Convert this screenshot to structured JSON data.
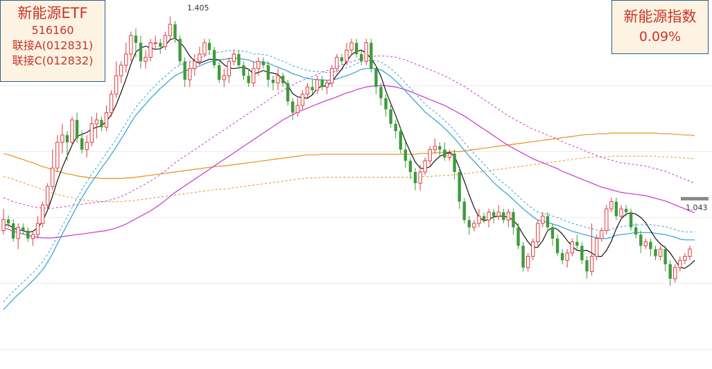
{
  "left_box": {
    "name": "新能源ETF",
    "code": "516160",
    "link_a": "联接A(012831)",
    "link_c": "联接C(012832)"
  },
  "right_box": {
    "name": "新能源指数",
    "pct": "0.09%"
  },
  "annotations": {
    "high_label": "1.405",
    "last_label": "1.043"
  },
  "colors": {
    "up": "#e03a3e",
    "down": "#3e9b3a",
    "ma_short": "#111111",
    "ma_mid": "#2a9fd8",
    "ma_long": "#cc33cc",
    "ma_longest": "#e8901c",
    "box_bg": "#fdf3e2",
    "box_text": "#c8342a"
  },
  "chart_data": {
    "type": "candlestick",
    "ylim": [
      0.87,
      1.43
    ],
    "high": 1.405,
    "last": 1.043,
    "candles": [
      [
        1.08,
        1.097,
        1.113,
        1.074
      ],
      [
        1.097,
        1.091,
        1.103,
        1.085
      ],
      [
        1.091,
        1.068,
        1.097,
        1.063
      ],
      [
        1.068,
        1.085,
        1.091,
        1.052
      ],
      [
        1.085,
        1.08,
        1.091,
        1.074
      ],
      [
        1.08,
        1.068,
        1.085,
        1.063
      ],
      [
        1.068,
        1.074,
        1.08,
        1.057
      ],
      [
        1.074,
        1.091,
        1.102,
        1.068
      ],
      [
        1.091,
        1.119,
        1.124,
        1.085
      ],
      [
        1.119,
        1.147,
        1.152,
        1.113
      ],
      [
        1.147,
        1.175,
        1.203,
        1.141
      ],
      [
        1.175,
        1.214,
        1.225,
        1.169
      ],
      [
        1.214,
        1.225,
        1.242,
        1.197
      ],
      [
        1.225,
        1.214,
        1.231,
        1.186
      ],
      [
        1.214,
        1.248,
        1.253,
        1.208
      ],
      [
        1.248,
        1.22,
        1.259,
        1.214
      ],
      [
        1.22,
        1.203,
        1.231,
        1.197
      ],
      [
        1.203,
        1.214,
        1.225,
        1.191
      ],
      [
        1.214,
        1.242,
        1.253,
        1.208
      ],
      [
        1.242,
        1.248,
        1.259,
        1.22
      ],
      [
        1.248,
        1.237,
        1.253,
        1.231
      ],
      [
        1.237,
        1.259,
        1.27,
        1.231
      ],
      [
        1.259,
        1.287,
        1.293,
        1.253
      ],
      [
        1.287,
        1.315,
        1.337,
        1.281
      ],
      [
        1.315,
        1.331,
        1.337,
        1.304
      ],
      [
        1.331,
        1.348,
        1.365,
        1.32
      ],
      [
        1.348,
        1.376,
        1.382,
        1.337
      ],
      [
        1.376,
        1.365,
        1.387,
        1.343
      ],
      [
        1.365,
        1.337,
        1.376,
        1.326
      ],
      [
        1.337,
        1.343,
        1.354,
        1.326
      ],
      [
        1.343,
        1.365,
        1.371,
        1.337
      ],
      [
        1.365,
        1.365,
        1.376,
        1.354
      ],
      [
        1.365,
        1.359,
        1.371,
        1.348
      ],
      [
        1.359,
        1.376,
        1.382,
        1.354
      ],
      [
        1.376,
        1.393,
        1.405,
        1.371
      ],
      [
        1.393,
        1.371,
        1.398,
        1.365
      ],
      [
        1.371,
        1.337,
        1.376,
        1.331
      ],
      [
        1.337,
        1.309,
        1.343,
        1.298
      ],
      [
        1.309,
        1.326,
        1.337,
        1.298
      ],
      [
        1.326,
        1.337,
        1.348,
        1.315
      ],
      [
        1.337,
        1.348,
        1.359,
        1.331
      ],
      [
        1.348,
        1.365,
        1.371,
        1.343
      ],
      [
        1.365,
        1.354,
        1.371,
        1.348
      ],
      [
        1.354,
        1.331,
        1.359,
        1.326
      ],
      [
        1.331,
        1.309,
        1.337,
        1.304
      ],
      [
        1.309,
        1.315,
        1.326,
        1.298
      ],
      [
        1.315,
        1.337,
        1.343,
        1.304
      ],
      [
        1.337,
        1.348,
        1.354,
        1.331
      ],
      [
        1.348,
        1.331,
        1.354,
        1.326
      ],
      [
        1.331,
        1.315,
        1.337,
        1.309
      ],
      [
        1.315,
        1.304,
        1.326,
        1.298
      ],
      [
        1.304,
        1.326,
        1.337,
        1.298
      ],
      [
        1.326,
        1.337,
        1.343,
        1.315
      ],
      [
        1.337,
        1.331,
        1.343,
        1.326
      ],
      [
        1.331,
        1.309,
        1.337,
        1.298
      ],
      [
        1.309,
        1.304,
        1.315,
        1.293
      ],
      [
        1.304,
        1.315,
        1.326,
        1.293
      ],
      [
        1.315,
        1.304,
        1.32,
        1.298
      ],
      [
        1.304,
        1.276,
        1.309,
        1.27
      ],
      [
        1.276,
        1.259,
        1.281,
        1.248
      ],
      [
        1.259,
        1.27,
        1.281,
        1.253
      ],
      [
        1.27,
        1.287,
        1.293,
        1.264
      ],
      [
        1.287,
        1.298,
        1.304,
        1.281
      ],
      [
        1.298,
        1.293,
        1.309,
        1.287
      ],
      [
        1.293,
        1.309,
        1.315,
        1.287
      ],
      [
        1.309,
        1.298,
        1.315,
        1.293
      ],
      [
        1.298,
        1.304,
        1.309,
        1.287
      ],
      [
        1.304,
        1.326,
        1.331,
        1.298
      ],
      [
        1.326,
        1.343,
        1.348,
        1.32
      ],
      [
        1.343,
        1.337,
        1.348,
        1.331
      ],
      [
        1.337,
        1.354,
        1.365,
        1.331
      ],
      [
        1.354,
        1.365,
        1.371,
        1.348
      ],
      [
        1.365,
        1.348,
        1.371,
        1.343
      ],
      [
        1.348,
        1.337,
        1.354,
        1.331
      ],
      [
        1.337,
        1.365,
        1.371,
        1.331
      ],
      [
        1.365,
        1.326,
        1.371,
        1.32
      ],
      [
        1.326,
        1.298,
        1.331,
        1.287
      ],
      [
        1.298,
        1.281,
        1.304,
        1.27
      ],
      [
        1.281,
        1.264,
        1.287,
        1.253
      ],
      [
        1.264,
        1.242,
        1.27,
        1.236
      ],
      [
        1.242,
        1.231,
        1.248,
        1.22
      ],
      [
        1.231,
        1.203,
        1.236,
        1.197
      ],
      [
        1.203,
        1.186,
        1.214,
        1.175
      ],
      [
        1.186,
        1.169,
        1.191,
        1.158
      ],
      [
        1.169,
        1.152,
        1.175,
        1.141
      ],
      [
        1.152,
        1.169,
        1.18,
        1.141
      ],
      [
        1.169,
        1.186,
        1.191,
        1.164
      ],
      [
        1.186,
        1.203,
        1.208,
        1.18
      ],
      [
        1.203,
        1.208,
        1.22,
        1.197
      ],
      [
        1.208,
        1.203,
        1.214,
        1.191
      ],
      [
        1.203,
        1.191,
        1.214,
        1.186
      ],
      [
        1.191,
        1.197,
        1.203,
        1.186
      ],
      [
        1.197,
        1.169,
        1.203,
        1.158
      ],
      [
        1.169,
        1.124,
        1.175,
        1.113
      ],
      [
        1.124,
        1.096,
        1.13,
        1.091
      ],
      [
        1.096,
        1.085,
        1.102,
        1.074
      ],
      [
        1.085,
        1.091,
        1.096,
        1.079
      ],
      [
        1.091,
        1.102,
        1.113,
        1.085
      ],
      [
        1.102,
        1.096,
        1.107,
        1.091
      ],
      [
        1.096,
        1.108,
        1.113,
        1.085
      ],
      [
        1.108,
        1.102,
        1.113,
        1.091
      ],
      [
        1.102,
        1.108,
        1.119,
        1.096
      ],
      [
        1.108,
        1.096,
        1.113,
        1.091
      ],
      [
        1.096,
        1.108,
        1.113,
        1.085
      ],
      [
        1.108,
        1.085,
        1.113,
        1.074
      ],
      [
        1.085,
        1.057,
        1.091,
        1.052
      ],
      [
        1.057,
        1.024,
        1.063,
        1.018
      ],
      [
        1.024,
        1.041,
        1.046,
        1.018
      ],
      [
        1.041,
        1.063,
        1.068,
        1.035
      ],
      [
        1.063,
        1.091,
        1.096,
        1.057
      ],
      [
        1.091,
        1.102,
        1.108,
        1.085
      ],
      [
        1.102,
        1.085,
        1.108,
        1.079
      ],
      [
        1.085,
        1.068,
        1.091,
        1.057
      ],
      [
        1.068,
        1.046,
        1.074,
        1.041
      ],
      [
        1.046,
        1.035,
        1.052,
        1.029
      ],
      [
        1.035,
        1.046,
        1.052,
        1.024
      ],
      [
        1.046,
        1.063,
        1.068,
        1.041
      ],
      [
        1.063,
        1.057,
        1.074,
        1.052
      ],
      [
        1.057,
        1.035,
        1.063,
        1.029
      ],
      [
        1.035,
        1.018,
        1.041,
        1.007
      ],
      [
        1.018,
        1.041,
        1.091,
        1.012
      ],
      [
        1.041,
        1.068,
        1.074,
        1.035
      ],
      [
        1.068,
        1.08,
        1.085,
        1.063
      ],
      [
        1.08,
        1.113,
        1.119,
        1.074
      ],
      [
        1.113,
        1.124,
        1.13,
        1.108
      ],
      [
        1.124,
        1.102,
        1.13,
        1.096
      ],
      [
        1.102,
        1.113,
        1.119,
        1.096
      ],
      [
        1.113,
        1.108,
        1.119,
        1.102
      ],
      [
        1.108,
        1.085,
        1.113,
        1.08
      ],
      [
        1.085,
        1.074,
        1.091,
        1.068
      ],
      [
        1.074,
        1.057,
        1.08,
        1.046
      ],
      [
        1.057,
        1.063,
        1.068,
        1.052
      ],
      [
        1.063,
        1.052,
        1.068,
        1.041
      ],
      [
        1.052,
        1.041,
        1.057,
        1.035
      ],
      [
        1.041,
        1.052,
        1.057,
        1.035
      ],
      [
        1.052,
        1.029,
        1.057,
        1.018
      ],
      [
        1.029,
        1.007,
        1.035,
        0.996
      ],
      [
        1.007,
        1.024,
        1.029,
        1.001
      ],
      [
        1.024,
        1.035,
        1.041,
        1.018
      ],
      [
        1.035,
        1.041,
        1.046,
        1.029
      ],
      [
        1.041,
        1.052,
        1.057,
        1.035
      ]
    ],
    "ma_short": [
      1.088,
      1.089,
      1.084,
      1.081,
      1.08,
      1.077,
      1.079,
      1.084,
      1.095,
      1.111,
      1.132,
      1.156,
      1.176,
      1.193,
      1.21,
      1.223,
      1.226,
      1.229,
      1.234,
      1.237,
      1.239,
      1.246,
      1.256,
      1.271,
      1.29,
      1.31,
      1.333,
      1.351,
      1.357,
      1.36,
      1.357,
      1.355,
      1.356,
      1.361,
      1.37,
      1.372,
      1.366,
      1.357,
      1.345,
      1.337,
      1.334,
      1.337,
      1.34,
      1.34,
      1.339,
      1.332,
      1.327,
      1.326,
      1.327,
      1.328,
      1.325,
      1.318,
      1.32,
      1.323,
      1.32,
      1.319,
      1.317,
      1.309,
      1.3,
      1.288,
      1.283,
      1.282,
      1.281,
      1.286,
      1.296,
      1.299,
      1.3,
      1.306,
      1.316,
      1.325,
      1.337,
      1.347,
      1.352,
      1.354,
      1.349,
      1.341,
      1.33,
      1.314,
      1.292,
      1.273,
      1.255,
      1.235,
      1.216,
      1.199,
      1.184,
      1.175,
      1.174,
      1.177,
      1.186,
      1.193,
      1.196,
      1.199,
      1.193,
      1.175,
      1.155,
      1.134,
      1.115,
      1.1,
      1.095,
      1.097,
      1.101,
      1.102,
      1.102,
      1.1,
      1.096,
      1.087,
      1.074,
      1.063,
      1.054,
      1.055,
      1.065,
      1.08,
      1.085,
      1.082,
      1.075,
      1.065,
      1.056,
      1.05,
      1.049,
      1.05,
      1.046,
      1.041,
      1.041,
      1.05,
      1.064,
      1.083,
      1.098,
      1.105,
      1.107,
      1.105,
      1.1,
      1.092,
      1.08,
      1.068,
      1.06,
      1.054,
      1.046,
      1.035,
      1.024,
      1.023,
      1.028,
      1.035
    ],
    "ma_mid": [
      0.96,
      0.968,
      0.976,
      0.983,
      0.99,
      0.997,
      1.004,
      1.012,
      1.021,
      1.032,
      1.045,
      1.06,
      1.075,
      1.089,
      1.103,
      1.117,
      1.13,
      1.142,
      1.154,
      1.164,
      1.175,
      1.185,
      1.196,
      1.207,
      1.219,
      1.231,
      1.244,
      1.255,
      1.264,
      1.272,
      1.281,
      1.288,
      1.296,
      1.302,
      1.309,
      1.315,
      1.319,
      1.322,
      1.325,
      1.327,
      1.33,
      1.333,
      1.336,
      1.338,
      1.339,
      1.34,
      1.341,
      1.342,
      1.341,
      1.34,
      1.339,
      1.336,
      1.336,
      1.335,
      1.334,
      1.331,
      1.328,
      1.325,
      1.322,
      1.318,
      1.316,
      1.313,
      1.311,
      1.31,
      1.309,
      1.309,
      1.308,
      1.309,
      1.31,
      1.313,
      1.315,
      1.318,
      1.321,
      1.325,
      1.326,
      1.326,
      1.326,
      1.324,
      1.319,
      1.314,
      1.307,
      1.3,
      1.292,
      1.284,
      1.276,
      1.268,
      1.26,
      1.254,
      1.248,
      1.242,
      1.235,
      1.228,
      1.22,
      1.211,
      1.202,
      1.193,
      1.185,
      1.177,
      1.169,
      1.161,
      1.153,
      1.146,
      1.14,
      1.134,
      1.127,
      1.12,
      1.113,
      1.107,
      1.101,
      1.096,
      1.094,
      1.093,
      1.09,
      1.088,
      1.085,
      1.082,
      1.079,
      1.077,
      1.075,
      1.073,
      1.071,
      1.069,
      1.068,
      1.068,
      1.07,
      1.073,
      1.074,
      1.075,
      1.076,
      1.077,
      1.077,
      1.077,
      1.077,
      1.076,
      1.075,
      1.074,
      1.072,
      1.07,
      1.067,
      1.066,
      1.066,
      1.066
    ],
    "ma_long": [
      1.085,
      1.082,
      1.079,
      1.077,
      1.075,
      1.073,
      1.071,
      1.07,
      1.069,
      1.069,
      1.069,
      1.07,
      1.071,
      1.072,
      1.073,
      1.074,
      1.075,
      1.076,
      1.077,
      1.078,
      1.079,
      1.08,
      1.082,
      1.084,
      1.087,
      1.09,
      1.094,
      1.098,
      1.102,
      1.106,
      1.11,
      1.115,
      1.12,
      1.126,
      1.132,
      1.138,
      1.143,
      1.148,
      1.153,
      1.158,
      1.163,
      1.168,
      1.173,
      1.178,
      1.183,
      1.188,
      1.193,
      1.198,
      1.203,
      1.208,
      1.213,
      1.218,
      1.223,
      1.228,
      1.233,
      1.238,
      1.243,
      1.248,
      1.252,
      1.256,
      1.26,
      1.263,
      1.266,
      1.269,
      1.272,
      1.275,
      1.278,
      1.28,
      1.283,
      1.286,
      1.289,
      1.291,
      1.294,
      1.296,
      1.298,
      1.299,
      1.3,
      1.3,
      1.3,
      1.299,
      1.298,
      1.296,
      1.294,
      1.291,
      1.288,
      1.285,
      1.282,
      1.279,
      1.276,
      1.273,
      1.27,
      1.266,
      1.262,
      1.258,
      1.254,
      1.249,
      1.244,
      1.239,
      1.234,
      1.229,
      1.224,
      1.219,
      1.214,
      1.209,
      1.205,
      1.201,
      1.197,
      1.193,
      1.189,
      1.186,
      1.183,
      1.18,
      1.177,
      1.174,
      1.17,
      1.167,
      1.164,
      1.161,
      1.158,
      1.155,
      1.152,
      1.149,
      1.146,
      1.144,
      1.142,
      1.14,
      1.138,
      1.137,
      1.136,
      1.135,
      1.134,
      1.133,
      1.131,
      1.129,
      1.127,
      1.125,
      1.122,
      1.119,
      1.116,
      1.113,
      1.11,
      1.107
    ],
    "ma_longest": [
      1.197,
      1.195,
      1.193,
      1.19,
      1.188,
      1.185,
      1.183,
      1.18,
      1.177,
      1.175,
      1.172,
      1.17,
      1.168,
      1.166,
      1.165,
      1.163,
      1.162,
      1.161,
      1.16,
      1.16,
      1.159,
      1.159,
      1.159,
      1.159,
      1.159,
      1.16,
      1.16,
      1.161,
      1.162,
      1.163,
      1.164,
      1.165,
      1.166,
      1.167,
      1.168,
      1.169,
      1.17,
      1.171,
      1.172,
      1.173,
      1.174,
      1.175,
      1.176,
      1.177,
      1.178,
      1.178,
      1.179,
      1.18,
      1.181,
      1.182,
      1.183,
      1.184,
      1.185,
      1.186,
      1.187,
      1.188,
      1.189,
      1.19,
      1.191,
      1.192,
      1.193,
      1.194,
      1.195,
      1.195,
      1.195,
      1.196,
      1.196,
      1.196,
      1.196,
      1.196,
      1.196,
      1.196,
      1.196,
      1.196,
      1.196,
      1.196,
      1.196,
      1.196,
      1.196,
      1.196,
      1.196,
      1.196,
      1.196,
      1.196,
      1.196,
      1.197,
      1.197,
      1.197,
      1.198,
      1.198,
      1.199,
      1.199,
      1.2,
      1.2,
      1.201,
      1.202,
      1.203,
      1.204,
      1.205,
      1.206,
      1.207,
      1.208,
      1.209,
      1.21,
      1.211,
      1.212,
      1.213,
      1.214,
      1.215,
      1.216,
      1.217,
      1.218,
      1.219,
      1.22,
      1.221,
      1.222,
      1.223,
      1.224,
      1.225,
      1.226,
      1.226,
      1.227,
      1.227,
      1.227,
      1.228,
      1.228,
      1.228,
      1.228,
      1.228,
      1.228,
      1.228,
      1.228,
      1.228,
      1.228,
      1.227,
      1.227,
      1.227,
      1.226,
      1.226,
      1.225,
      1.225,
      1.224
    ]
  }
}
